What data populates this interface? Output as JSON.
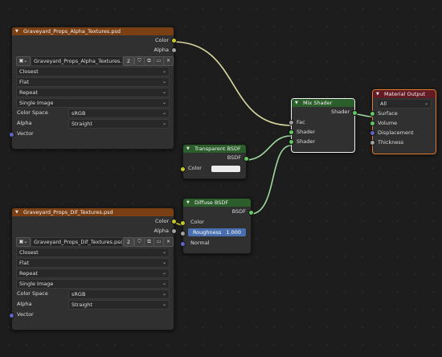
{
  "alpha_tex": {
    "title": "Graveyard_Props_Alpha_Textures.psd",
    "outputs": [
      "Color",
      "Alpha"
    ],
    "image_name": "Graveyard_Props_Alpha_Textures....",
    "users": "2",
    "interpolation": "Closest",
    "projection": "Flat",
    "extension": "Repeat",
    "source": "Single Image",
    "color_space_label": "Color Space",
    "color_space": "sRGB",
    "alpha_label": "Alpha",
    "alpha_mode": "Straight",
    "vector_label": "Vector"
  },
  "diff_tex": {
    "title": "Graveyard_Props_Dif_Textures.psd",
    "outputs": [
      "Color",
      "Alpha"
    ],
    "image_name": "Graveyard_Props_Dif_Textures.psd",
    "users": "2",
    "interpolation": "Closest",
    "projection": "Flat",
    "extension": "Repeat",
    "source": "Single Image",
    "color_space_label": "Color Space",
    "color_space": "sRGB",
    "alpha_label": "Alpha",
    "alpha_mode": "Straight",
    "vector_label": "Vector"
  },
  "transparent": {
    "title": "Transparent BSDF",
    "output": "BSDF",
    "color_label": "Color",
    "color_value": "#ececec"
  },
  "diffuse": {
    "title": "Diffuse BSDF",
    "output": "BSDF",
    "color_label": "Color",
    "roughness_label": "Roughness",
    "roughness_value": "1.000",
    "normal_label": "Normal"
  },
  "mix": {
    "title": "Mix Shader",
    "output": "Shader",
    "inputs": [
      "Fac",
      "Shader",
      "Shader"
    ]
  },
  "material_output": {
    "title": "Material Output",
    "target": "All",
    "inputs": [
      "Surface",
      "Volume",
      "Displacement",
      "Thickness"
    ]
  },
  "colors": {
    "background": "#1d1d1d",
    "node_body": "#303030",
    "texture_header": "#7b3f14",
    "shader_header": "#2b5e2b",
    "output_header": "#631c24",
    "socket_color": "#c7c729",
    "socket_float": "#a1a1a1",
    "socket_shader": "#63c763",
    "socket_vector": "#6363c7",
    "selected_outline": "#e07a2a",
    "slider_fill": "#4a6fae"
  },
  "icons": {
    "image_picker": "image-icon",
    "fake_user": "shield-icon",
    "duplicate": "duplicate-icon",
    "open": "folder-icon",
    "unlink": "close-icon",
    "collapse": "chevron-down-icon"
  }
}
